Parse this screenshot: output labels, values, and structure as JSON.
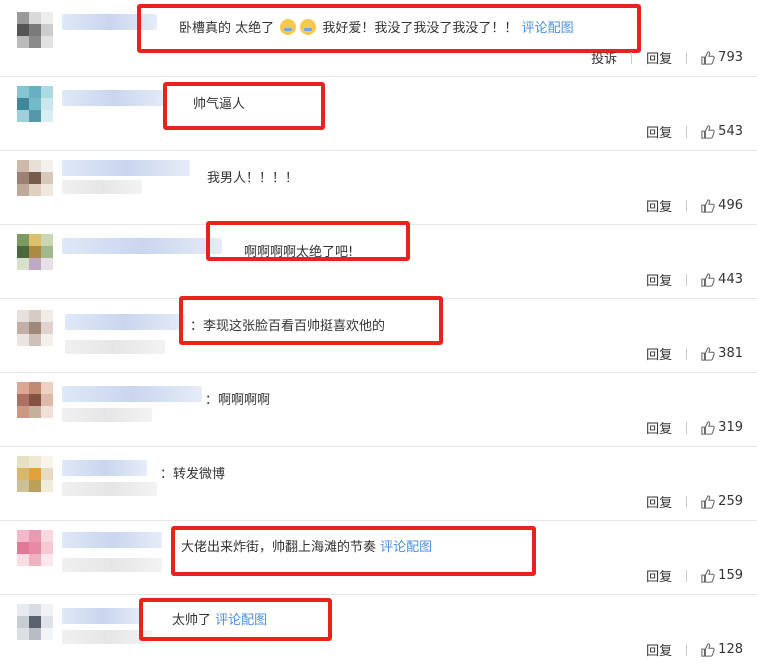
{
  "actions": {
    "reply_label": "回复",
    "report_label": "投诉"
  },
  "comments": [
    {
      "prefix": "",
      "text": "卧槽真的 太绝了",
      "emoji_text": "我好爱！我没了我没了我没了！！",
      "link": "评论配图",
      "likes": "793"
    },
    {
      "prefix": "",
      "text": "帅气逼人",
      "link": "",
      "likes": "543"
    },
    {
      "prefix": "",
      "text": "我男人！！！！",
      "link": "",
      "likes": "496"
    },
    {
      "prefix": "",
      "text": "啊啊啊啊太绝了吧!",
      "link": "",
      "likes": "443"
    },
    {
      "prefix": "：",
      "text": "李现这张脸百看百帅挺喜欢他的",
      "link": "",
      "likes": "381"
    },
    {
      "prefix": "：",
      "text": "啊啊啊啊",
      "link": "",
      "likes": "319"
    },
    {
      "prefix": "：",
      "text": "转发微博",
      "link": "",
      "likes": "259"
    },
    {
      "prefix": "",
      "text": "大佬出来炸街，帅翻上海滩的节奏",
      "link": "评论配图",
      "likes": "159"
    },
    {
      "prefix": "",
      "text": "太帅了",
      "link": "评论配图",
      "likes": "128"
    }
  ],
  "colors": {
    "highlight": "#e8231e",
    "link": "#4a90e2"
  }
}
